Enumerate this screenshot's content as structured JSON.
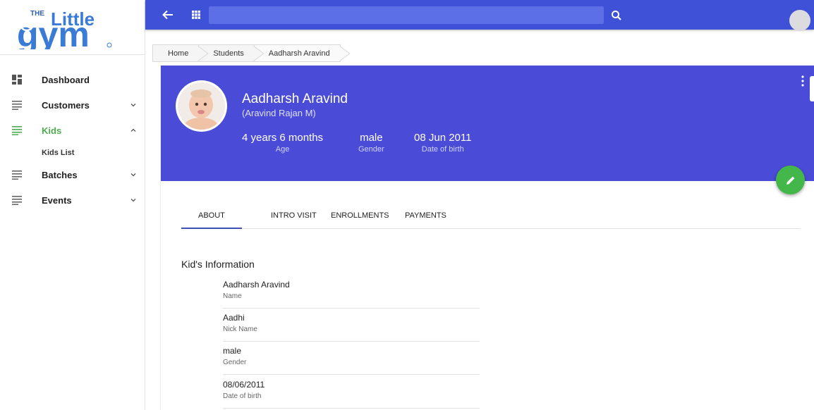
{
  "brand": {
    "logo_text_top": "THE",
    "logo_text_main": "Little",
    "logo_text_bottom": "gym"
  },
  "sidebar": {
    "items": [
      {
        "label": "Dashboard",
        "icon": "dashboard-icon"
      },
      {
        "label": "Customers",
        "icon": "list-icon",
        "expanded": false
      },
      {
        "label": "Kids",
        "icon": "list-icon",
        "expanded": true,
        "active": true,
        "children": [
          "Kids List"
        ]
      },
      {
        "label": "Batches",
        "icon": "list-icon",
        "expanded": false
      },
      {
        "label": "Events",
        "icon": "list-icon",
        "expanded": false
      }
    ]
  },
  "topbar": {
    "search_value": "",
    "icons": [
      "back-arrow-icon",
      "apps-grid-icon",
      "search-icon",
      "user-avatar"
    ]
  },
  "breadcrumb": [
    "Home",
    "Students",
    "Aadharsh Aravind"
  ],
  "profile": {
    "name": "Aadharsh Aravind",
    "parent": "(Aravind Rajan M)",
    "stats": [
      {
        "value": "4 years 6 months",
        "label": "Age"
      },
      {
        "value": "male",
        "label": "Gender"
      },
      {
        "value": "08 Jun 2011",
        "label": "Date of birth"
      }
    ]
  },
  "tabs": [
    "ABOUT",
    "INTRO VISIT",
    "ENROLLMENTS",
    "PAYMENTS"
  ],
  "active_tab": "ABOUT",
  "kids_info": {
    "title": "Kid's Information",
    "fields": [
      {
        "value": "Aadharsh Aravind",
        "label": "Name"
      },
      {
        "value": "Aadhi",
        "label": "Nick Name"
      },
      {
        "value": "male",
        "label": "Gender"
      },
      {
        "value": "08/06/2011",
        "label": "Date of birth"
      }
    ]
  },
  "colors": {
    "primary": "#3f51d6",
    "hero": "#4a4bd6",
    "accent_green": "#43b749",
    "active_nav": "#4cae4c"
  }
}
